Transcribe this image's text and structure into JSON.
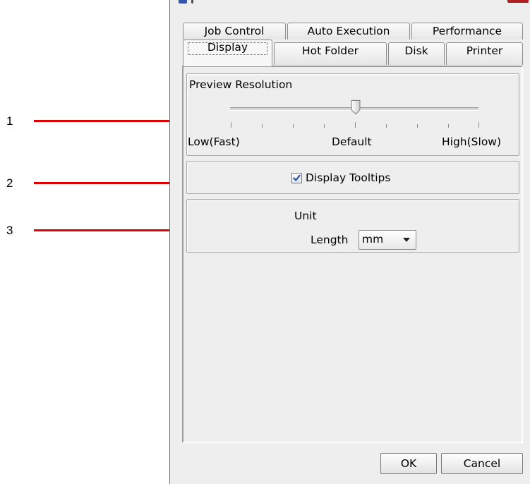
{
  "callouts": [
    "1",
    "2",
    "3"
  ],
  "tabs_row1": [
    "Job Control",
    "Auto Execution",
    "Performance"
  ],
  "tabs_row2": [
    "Display",
    "Hot Folder",
    "Disk",
    "Printer"
  ],
  "active_tab": "Display",
  "preview": {
    "group_label": "Preview Resolution",
    "low_label": "Low(Fast)",
    "default_label": "Default",
    "high_label": "High(Slow)",
    "slider_value": 0.5
  },
  "tooltips": {
    "label": "Display Tooltips",
    "checked": true
  },
  "unit": {
    "group_label": "Unit",
    "length_label": "Length",
    "length_value": "mm"
  },
  "buttons": {
    "ok": "OK",
    "cancel": "Cancel"
  },
  "colors": {
    "callout_line": "#e00000",
    "checkmark": "#2b4f9e",
    "title_mark_blue": "#3355aa",
    "title_mark_red": "#b02020"
  }
}
